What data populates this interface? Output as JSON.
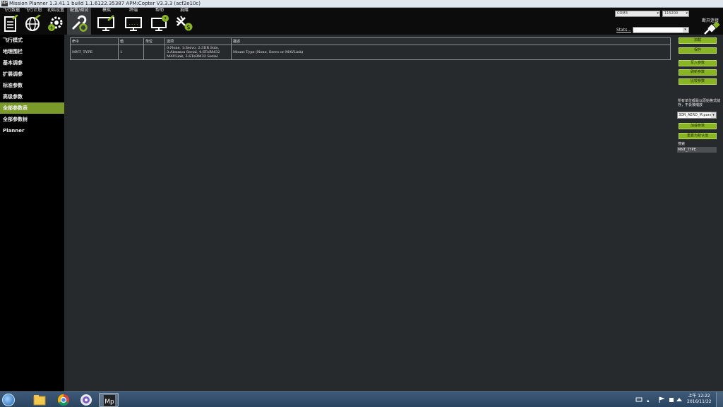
{
  "window": {
    "title": "Mission Planner 1.3.41.1 build 1.1.6122.35387 APM:Copter V3.3.3 (acf2e10c)",
    "icon": "MP"
  },
  "toolbar": {
    "tools": [
      {
        "label": "飞行数据",
        "icon": "flight-data-icon"
      },
      {
        "label": "飞行计划",
        "icon": "flight-plan-icon"
      },
      {
        "label": "初始设置",
        "icon": "initial-setup-icon"
      },
      {
        "label": "配置/调试",
        "icon": "config-tuning-icon"
      },
      {
        "label": "模拟",
        "icon": "simulation-icon"
      },
      {
        "label": "终端",
        "icon": "terminal-icon"
      },
      {
        "label": "帮助",
        "icon": "help-icon"
      },
      {
        "label": "捐赠",
        "icon": "donate-icon"
      }
    ],
    "port": "COM3",
    "baud": "115200",
    "stats_label": "Stats...",
    "connect_label": "断开连接"
  },
  "sidebar": {
    "items": [
      {
        "label": "飞行模式"
      },
      {
        "label": "地理围栏"
      },
      {
        "label": "基本调参"
      },
      {
        "label": "扩展调参"
      },
      {
        "label": "标准参数"
      },
      {
        "label": "高级参数"
      },
      {
        "label": "全部参数表"
      },
      {
        "label": "全部参数树"
      },
      {
        "label": "Planner"
      }
    ],
    "active_index": 6
  },
  "params_table": {
    "headers": [
      "命令",
      "值",
      "单位",
      "选项",
      "描述"
    ],
    "rows": [
      {
        "command": "MNT_TYPE",
        "value": "1",
        "units": "",
        "options": "0:None, 1:Servo, 2:3DR Solo, 3:Alexmos Serial, 4:SToRM32 MAVLink, 5:SToRM32 Serial",
        "description": "Mount Type (None, Servo or MAVLink)"
      }
    ]
  },
  "right_panel": {
    "load_label": "加载",
    "save_label": "保存",
    "write_label": "写入参数",
    "refresh_label": "刷新参数",
    "compare_label": "比较参数",
    "note": "所有单位都是以原始格式储存，不会被缩放",
    "param_file": "3DR_AERO_M.param",
    "load_preset_label": "加载参数",
    "reset_default_label": "重置为默认值",
    "search_label": "搜索",
    "search_value": "MNT_TYPE"
  },
  "taskbar": {
    "apps": [
      "explorer-icon",
      "chrome-icon",
      "media-player-icon",
      "mission-planner-icon"
    ],
    "time": "上午 12:22",
    "date": "2016/11/22"
  }
}
